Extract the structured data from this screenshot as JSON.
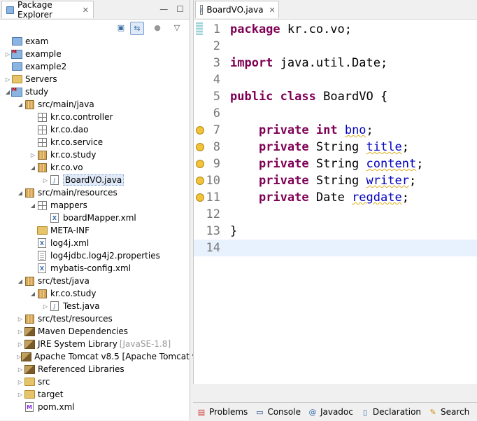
{
  "explorer": {
    "tab_label": "Package Explorer",
    "tab_close": "✕",
    "minimize": "—",
    "maximize": "☐",
    "tree": [
      {
        "label": "exam",
        "icon": "folder"
      },
      {
        "label": "example",
        "icon": "maven-project"
      },
      {
        "label": "example2",
        "icon": "folder"
      },
      {
        "label": "Servers",
        "icon": "folder"
      },
      {
        "label": "study",
        "icon": "maven-project"
      },
      {
        "label": "src/main/java",
        "icon": "source-folder"
      },
      {
        "label": "kr.co.controller",
        "icon": "package-empty"
      },
      {
        "label": "kr.co.dao",
        "icon": "package-empty"
      },
      {
        "label": "kr.co.service",
        "icon": "package-empty"
      },
      {
        "label": "kr.co.study",
        "icon": "package"
      },
      {
        "label": "kr.co.vo",
        "icon": "package"
      },
      {
        "label": "BoardVO.java",
        "icon": "java-file"
      },
      {
        "label": "src/main/resources",
        "icon": "source-folder"
      },
      {
        "label": "mappers",
        "icon": "package-empty"
      },
      {
        "label": "boardMapper.xml",
        "icon": "xml-file"
      },
      {
        "label": "META-INF",
        "icon": "folder"
      },
      {
        "label": "log4j.xml",
        "icon": "xml-file"
      },
      {
        "label": "log4jdbc.log4j2.properties",
        "icon": "properties-file"
      },
      {
        "label": "mybatis-config.xml",
        "icon": "xml-file"
      },
      {
        "label": "src/test/java",
        "icon": "source-folder"
      },
      {
        "label": "kr.co.study",
        "icon": "package"
      },
      {
        "label": "Test.java",
        "icon": "java-file"
      },
      {
        "label": "src/test/resources",
        "icon": "source-folder"
      },
      {
        "label": "Maven Dependencies",
        "icon": "library"
      },
      {
        "label": "JRE System Library",
        "decoration": "[JavaSE-1.8]",
        "icon": "library"
      },
      {
        "label": "Apache Tomcat v8.5 [Apache Tomcat v",
        "icon": "library"
      },
      {
        "label": "Referenced Libraries",
        "icon": "library"
      },
      {
        "label": "src",
        "icon": "folder"
      },
      {
        "label": "target",
        "icon": "folder"
      },
      {
        "label": "pom.xml",
        "icon": "maven-file"
      }
    ]
  },
  "editor": {
    "tab_label": "BoardVO.java",
    "tab_close": "✕",
    "lines": [
      {
        "n": "1"
      },
      {
        "n": "2"
      },
      {
        "n": "3"
      },
      {
        "n": "4"
      },
      {
        "n": "5"
      },
      {
        "n": "6"
      },
      {
        "n": "7"
      },
      {
        "n": "8"
      },
      {
        "n": "9"
      },
      {
        "n": "10"
      },
      {
        "n": "11"
      },
      {
        "n": "12"
      },
      {
        "n": "13"
      },
      {
        "n": "14"
      }
    ],
    "code": {
      "l1_kw": "package",
      "l1_rest": " kr.co.vo;",
      "l3_kw": "import",
      "l3_rest": " java.util.Date;",
      "l5_kw1": "public",
      "l5_kw2": "class",
      "l5_rest": " BoardVO {",
      "private": "private",
      "int": "int",
      "bno": "bno",
      "string": "String",
      "title": "title",
      "content": "content",
      "writer": "writer",
      "date": "Date",
      "regdate": "regdate",
      "semi": ";",
      "close_brace": "}"
    }
  },
  "bottom_tabs": [
    {
      "label": "Problems",
      "icon": "problems-icon"
    },
    {
      "label": "Console",
      "icon": "console-icon"
    },
    {
      "label": "Javadoc",
      "icon": "javadoc-icon"
    },
    {
      "label": "Declaration",
      "icon": "declaration-icon"
    },
    {
      "label": "Search",
      "icon": "search-icon"
    }
  ]
}
